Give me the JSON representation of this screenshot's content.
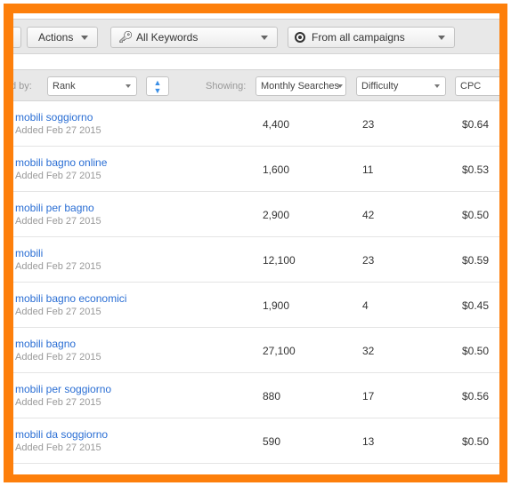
{
  "toolbar": {
    "actions_label": "Actions",
    "keywords_select": "All Keywords",
    "campaigns_select": "From all campaigns"
  },
  "sortbar": {
    "sorted_by_label": "d by:",
    "sort_value": "Rank",
    "showing_label": "Showing:",
    "col1": "Monthly Searches",
    "col2": "Difficulty",
    "col3": "CPC"
  },
  "rows": [
    {
      "keyword": "mobili soggiorno",
      "added": "Added Feb 27 2015",
      "searches": "4,400",
      "difficulty": "23",
      "cpc": "$0.64"
    },
    {
      "keyword": "mobili bagno online",
      "added": "Added Feb 27 2015",
      "searches": "1,600",
      "difficulty": "11",
      "cpc": "$0.53"
    },
    {
      "keyword": "mobili per bagno",
      "added": "Added Feb 27 2015",
      "searches": "2,900",
      "difficulty": "42",
      "cpc": "$0.50"
    },
    {
      "keyword": "mobili",
      "added": "Added Feb 27 2015",
      "searches": "12,100",
      "difficulty": "23",
      "cpc": "$0.59"
    },
    {
      "keyword": "mobili bagno economici",
      "added": "Added Feb 27 2015",
      "searches": "1,900",
      "difficulty": "4",
      "cpc": "$0.45"
    },
    {
      "keyword": "mobili bagno",
      "added": "Added Feb 27 2015",
      "searches": "27,100",
      "difficulty": "32",
      "cpc": "$0.50"
    },
    {
      "keyword": "mobili per soggiorno",
      "added": "Added Feb 27 2015",
      "searches": "880",
      "difficulty": "17",
      "cpc": "$0.56"
    },
    {
      "keyword": "mobili da soggiorno",
      "added": "Added Feb 27 2015",
      "searches": "590",
      "difficulty": "13",
      "cpc": "$0.50"
    }
  ],
  "colors": {
    "frame": "#fd7f0b",
    "link": "#2a6ed4"
  }
}
